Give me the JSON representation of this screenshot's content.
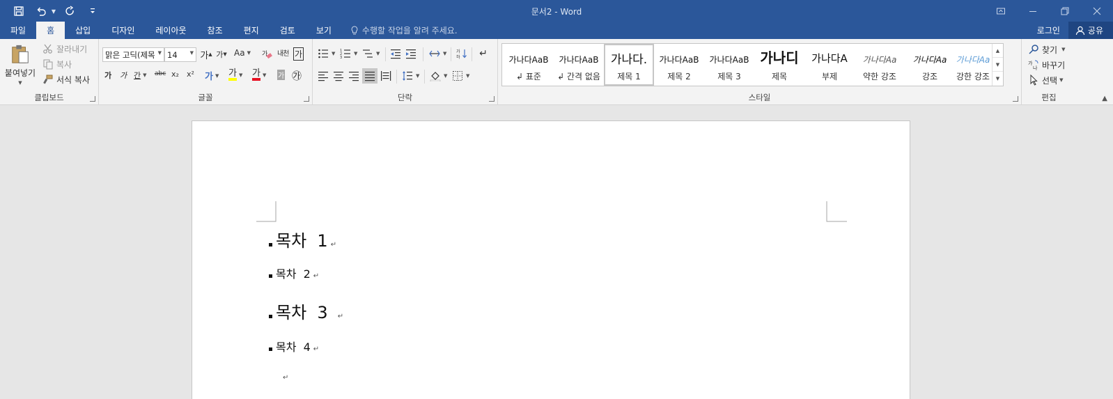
{
  "window": {
    "title": "문서2 - Word"
  },
  "tabs": [
    "파일",
    "홈",
    "삽입",
    "디자인",
    "레이아웃",
    "참조",
    "편지",
    "검토",
    "보기"
  ],
  "active_tab": "홈",
  "tell_me": "수행할 작업을 알려 주세요.",
  "account": {
    "login": "로그인",
    "share": "공유"
  },
  "clipboard": {
    "paste": "붙여넣기",
    "cut": "잘라내기",
    "copy": "복사",
    "format_painter": "서식 복사",
    "label": "클립보드"
  },
  "font": {
    "name": "맑은 고딕(제목",
    "size": "14",
    "label": "글꼴",
    "grow": "가",
    "shrink": "가",
    "case": "Aa",
    "bold": "가",
    "italic": "가",
    "underline": "간",
    "strike": "abc",
    "subscript": "x₂",
    "superscript": "x²",
    "effects": "가",
    "highlight": "가",
    "color": "가",
    "shading": "가",
    "enclose": "㉮",
    "phonetic": "내천",
    "border": "가"
  },
  "paragraph": {
    "label": "단락"
  },
  "styles": {
    "label": "스타일",
    "items": [
      {
        "sample": "가나다AaB",
        "name": "↲ 표준"
      },
      {
        "sample": "가나다AaB",
        "name": "↲ 간격 없음"
      },
      {
        "sample": "가나다.",
        "name": "제목 1"
      },
      {
        "sample": "가나다AaB",
        "name": "제목 2"
      },
      {
        "sample": "가나다AaB",
        "name": "제목 3"
      },
      {
        "sample": "가나디",
        "name": "제목"
      },
      {
        "sample": "가나다A",
        "name": "부제"
      },
      {
        "sample": "가나다Aa",
        "name": "약한 강조"
      },
      {
        "sample": "가나다Aa",
        "name": "강조"
      },
      {
        "sample": "가나다Aa",
        "name": "강한 강조"
      }
    ]
  },
  "editing": {
    "find": "찾기",
    "replace": "바꾸기",
    "select": "선택",
    "label": "편집"
  },
  "document": {
    "lines": [
      {
        "text": "목차  1",
        "level": "heading"
      },
      {
        "text": "목차  2",
        "level": "normal"
      },
      {
        "text": "목차  3",
        "level": "heading"
      },
      {
        "text": "목차  4",
        "level": "normal"
      }
    ],
    "paragraph_mark": "↵"
  },
  "colors": {
    "title_bar": "#2b579a",
    "ribbon": "#f3f3f3",
    "highlight": "#ffff00",
    "font_color": "#e81123",
    "style_emphasis": "#5b9bd5"
  }
}
